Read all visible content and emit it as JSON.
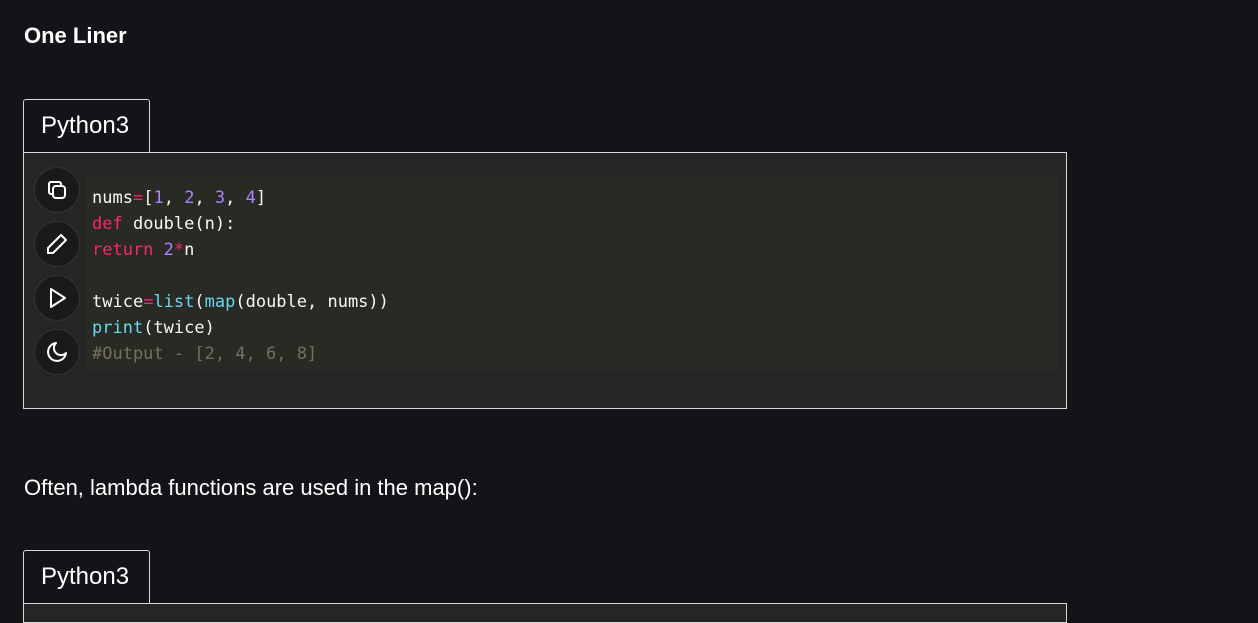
{
  "section_heading": "One Liner",
  "code_blocks": [
    {
      "language_tab": "Python3",
      "tools": [
        {
          "name": "copy",
          "icon": "copy-icon"
        },
        {
          "name": "edit",
          "icon": "pencil-icon"
        },
        {
          "name": "run",
          "icon": "play-icon"
        },
        {
          "name": "theme",
          "icon": "moon-icon"
        }
      ],
      "lines": [
        {
          "t1": "nums",
          "t2": "=",
          "t3": "[",
          "n1": "1",
          "c1": ", ",
          "n2": "2",
          "c2": ", ",
          "n3": "3",
          "c3": ", ",
          "n4": "4",
          "t4": "]"
        },
        {
          "kw": "def",
          "rest": " double(n):"
        },
        {
          "kw": "return",
          "sp": " ",
          "num": "2",
          "op": "*",
          "rest": "n"
        },
        {},
        {
          "a": "twice",
          "op": "=",
          "bi1": "list",
          "p1": "(",
          "bi2": "map",
          "rest": "(double, nums))"
        },
        {
          "bi": "print",
          "rest": "(twice)"
        },
        {
          "comment": "#Output - [2, 4, 6, 8]"
        }
      ]
    },
    {
      "language_tab": "Python3"
    }
  ],
  "paragraph": "Often, lambda functions are used in the map():"
}
